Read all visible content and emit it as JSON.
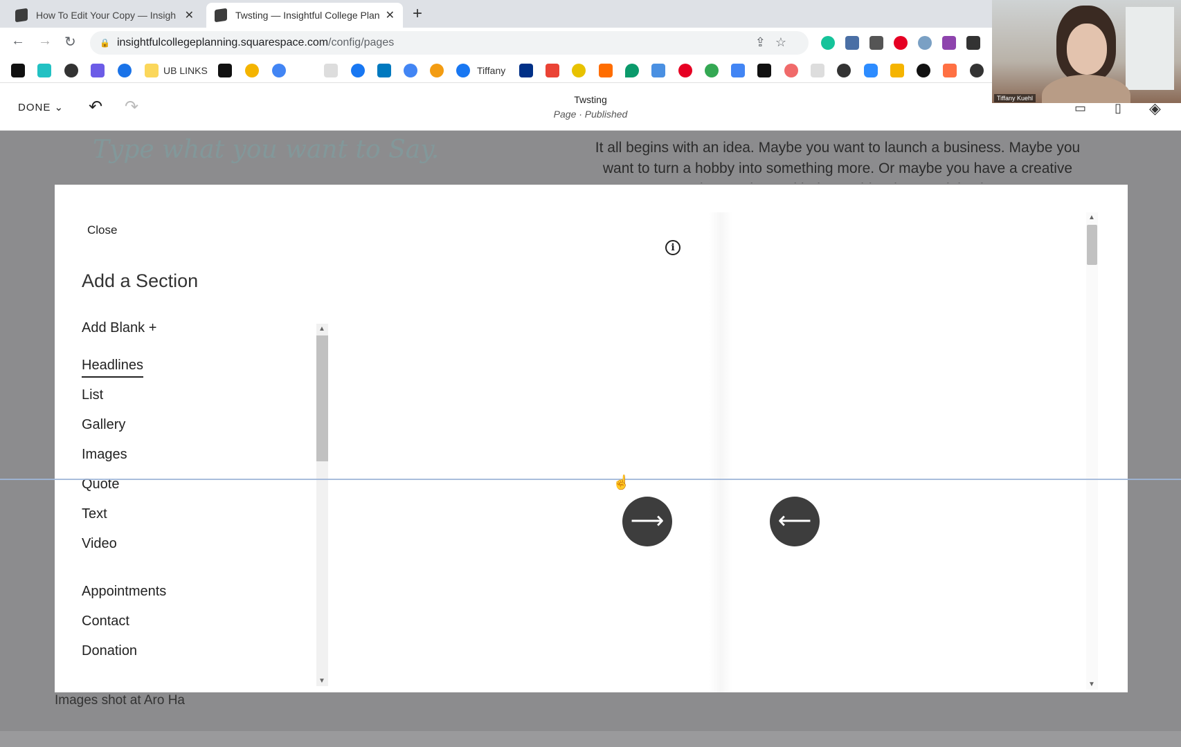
{
  "browser": {
    "tabs": [
      {
        "title": "How To Edit Your Copy — Insigh",
        "active": false
      },
      {
        "title": "Twsting — Insightful College Plan",
        "active": true
      }
    ],
    "new_tab_label": "+",
    "close_glyph": "✕",
    "url_host": "insightfulcollegeplanning.squarespace.com",
    "url_path": "/config/pages",
    "bookmark_labels": [
      "UB LINKS",
      "Tiffany"
    ]
  },
  "editor": {
    "done_label": "DONE",
    "page_title": "Twsting",
    "page_status": "Page · Published"
  },
  "page_background": {
    "script_heading": "Type what you want to Say.",
    "paragraph": "It all begins with an idea. Maybe you want to launch a business. Maybe you want to turn a hobby into something more. Or maybe you have a creative project to share with the world. Whatever it is, the",
    "caption": "Images shot at Aro Ha"
  },
  "modal": {
    "close_label": "Close",
    "title": "Add a Section",
    "add_blank_label": "Add Blank +",
    "categories": [
      "Headlines",
      "List",
      "Gallery",
      "Images",
      "Quote",
      "Text",
      "Video"
    ],
    "categories_more": [
      "Appointments",
      "Contact",
      "Donation"
    ],
    "selected_category": "Headlines"
  },
  "webcam": {
    "name": "Tiffany Kuehl"
  },
  "colors": {
    "overlay_gray": "#8c8c8e",
    "nav_circle": "#3d3d3d",
    "script_teal": "#7f9ea0"
  }
}
